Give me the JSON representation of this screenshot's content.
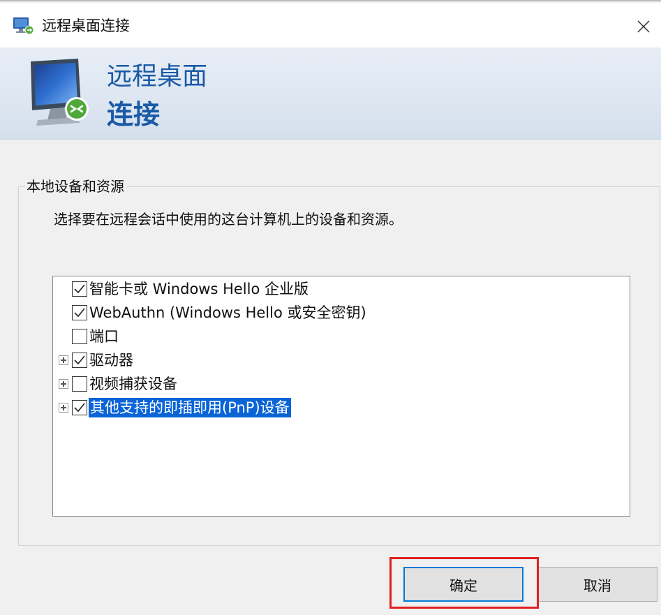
{
  "window": {
    "title": "远程桌面连接",
    "icon": "remote-desktop-icon",
    "close_icon": "close-icon"
  },
  "banner": {
    "line1": "远程桌面",
    "line2": "连接",
    "title_color": "#1a5aa6"
  },
  "group": {
    "legend": "本地设备和资源",
    "description": "选择要在远程会话中使用的这台计算机上的设备和资源。"
  },
  "tree": {
    "items": [
      {
        "label": "智能卡或 Windows Hello 企业版",
        "checked": true,
        "expandable": false,
        "selected": false
      },
      {
        "label": "WebAuthn (Windows Hello 或安全密钥)",
        "checked": true,
        "expandable": false,
        "selected": false
      },
      {
        "label": "端口",
        "checked": false,
        "expandable": false,
        "selected": false
      },
      {
        "label": "驱动器",
        "checked": true,
        "expandable": true,
        "selected": false
      },
      {
        "label": "视频捕获设备",
        "checked": false,
        "expandable": true,
        "selected": false
      },
      {
        "label": "其他支持的即插即用(PnP)设备",
        "checked": true,
        "expandable": true,
        "selected": true
      }
    ]
  },
  "buttons": {
    "ok": "确定",
    "cancel": "取消"
  },
  "colors": {
    "selection": "#0a64d6",
    "highlight_box": "#e02020",
    "default_button_border": "#0078d7"
  }
}
